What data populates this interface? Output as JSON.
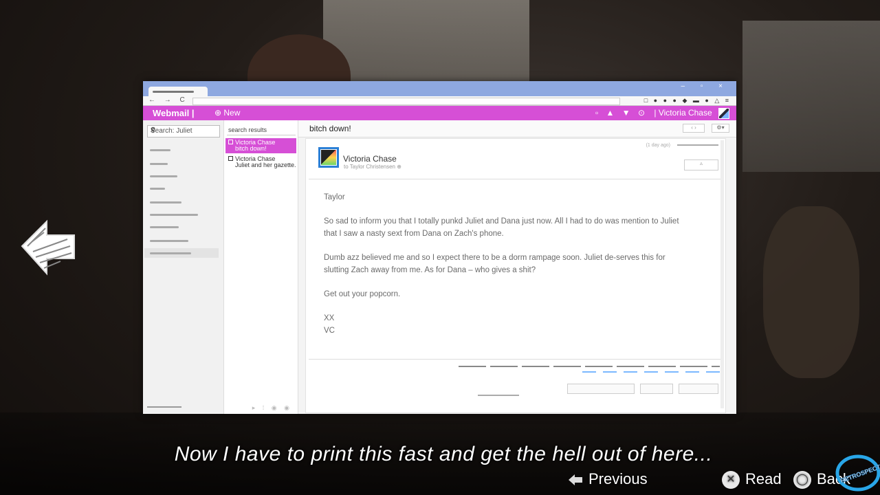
{
  "browser": {
    "window_controls": "– ▫ ×",
    "nav_glyphs": "← → C ⌂",
    "ext_glyphs": "□ ● ● ● ◆ ▬ ● △ ≡"
  },
  "app": {
    "brand": "Webmail |",
    "new_label": "⊕ New",
    "header_icons": "▫ ▲ ▼ ⊙",
    "user_name": "| Victoria Chase",
    "accent_color": "#d64fd6"
  },
  "search": {
    "value": "Search: Juliet",
    "clear": "x",
    "search_glyph": "⚲"
  },
  "results": {
    "heading": "search results",
    "items": [
      {
        "from": "Victoria Chase",
        "subject": "bitch down!",
        "selected": true
      },
      {
        "from": "Victoria Chase",
        "subject": "Juliet and her gazette...",
        "selected": false
      }
    ],
    "footer_icons": "▸ ⁞ ◉ ◉"
  },
  "message": {
    "subject": "bitch down!",
    "pager": "‹ ›",
    "settings": "⚙▾",
    "sender": "Victoria Chase",
    "to": "to Taylor Christensen ⊕",
    "date": "(1 day ago)",
    "reply_glyph": "▵",
    "greeting": "Taylor",
    "paragraph1": "So sad to inform you that I totally punkd Juliet and Dana just now. All I had to do was mention to Juliet that I saw a nasty sext from Dana on Zach's phone.",
    "paragraph2": "Dumb azz believed me and so I expect there to be a dorm rampage soon. Juliet de-serves this for slutting Zach away from me. As for Dana – who gives a shit?",
    "paragraph3": "Get out your popcorn.",
    "signoff1": "XX",
    "signoff2": "VC"
  },
  "game": {
    "subtitle": "Now I have to print this fast and get the hell out of here...",
    "previous_label": "Previous",
    "read_label": "Read",
    "back_label": "Back",
    "read_button": "✕",
    "back_button": "◯",
    "watermark": "RETROSPECT"
  }
}
